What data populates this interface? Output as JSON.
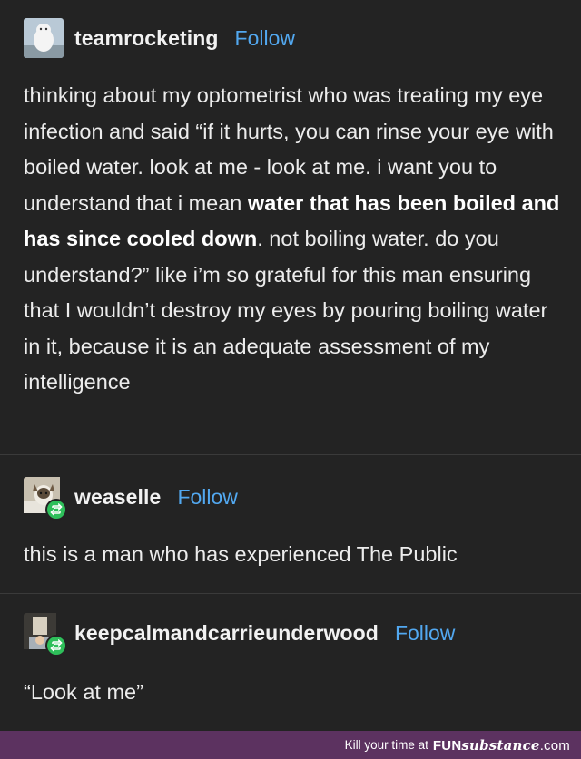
{
  "posts": [
    {
      "username": "teamrocketing",
      "follow_label": "Follow",
      "body": {
        "part1": "thinking about my optometrist who was treating my eye infection and said “if it hurts, you can rinse your eye with boiled water. look at me - look at me. i want you to understand that i mean ",
        "bold": "water that has been boiled and has since cooled down",
        "part2": ". not boiling water. do you understand?” like i’m so grateful for this man ensuring that I wouldn’t destroy my eyes by pouring boiling water in it, because it is an adequate assessment of my intelligence"
      }
    },
    {
      "username": "weaselle",
      "follow_label": "Follow",
      "body": "this is a man who has experienced The Public"
    },
    {
      "username": "keepcalmandcarrieunderwood",
      "follow_label": "Follow",
      "body": "“Look at me”"
    }
  ],
  "footer": {
    "text": "Kill your time at",
    "brand_part1": "FUN",
    "brand_part2": "substance",
    "brand_part3": ".com"
  },
  "colors": {
    "background": "#232323",
    "follow": "#52a8f0",
    "reblog_badge": "#2ebf5a",
    "footer_bg": "#5c3260"
  }
}
